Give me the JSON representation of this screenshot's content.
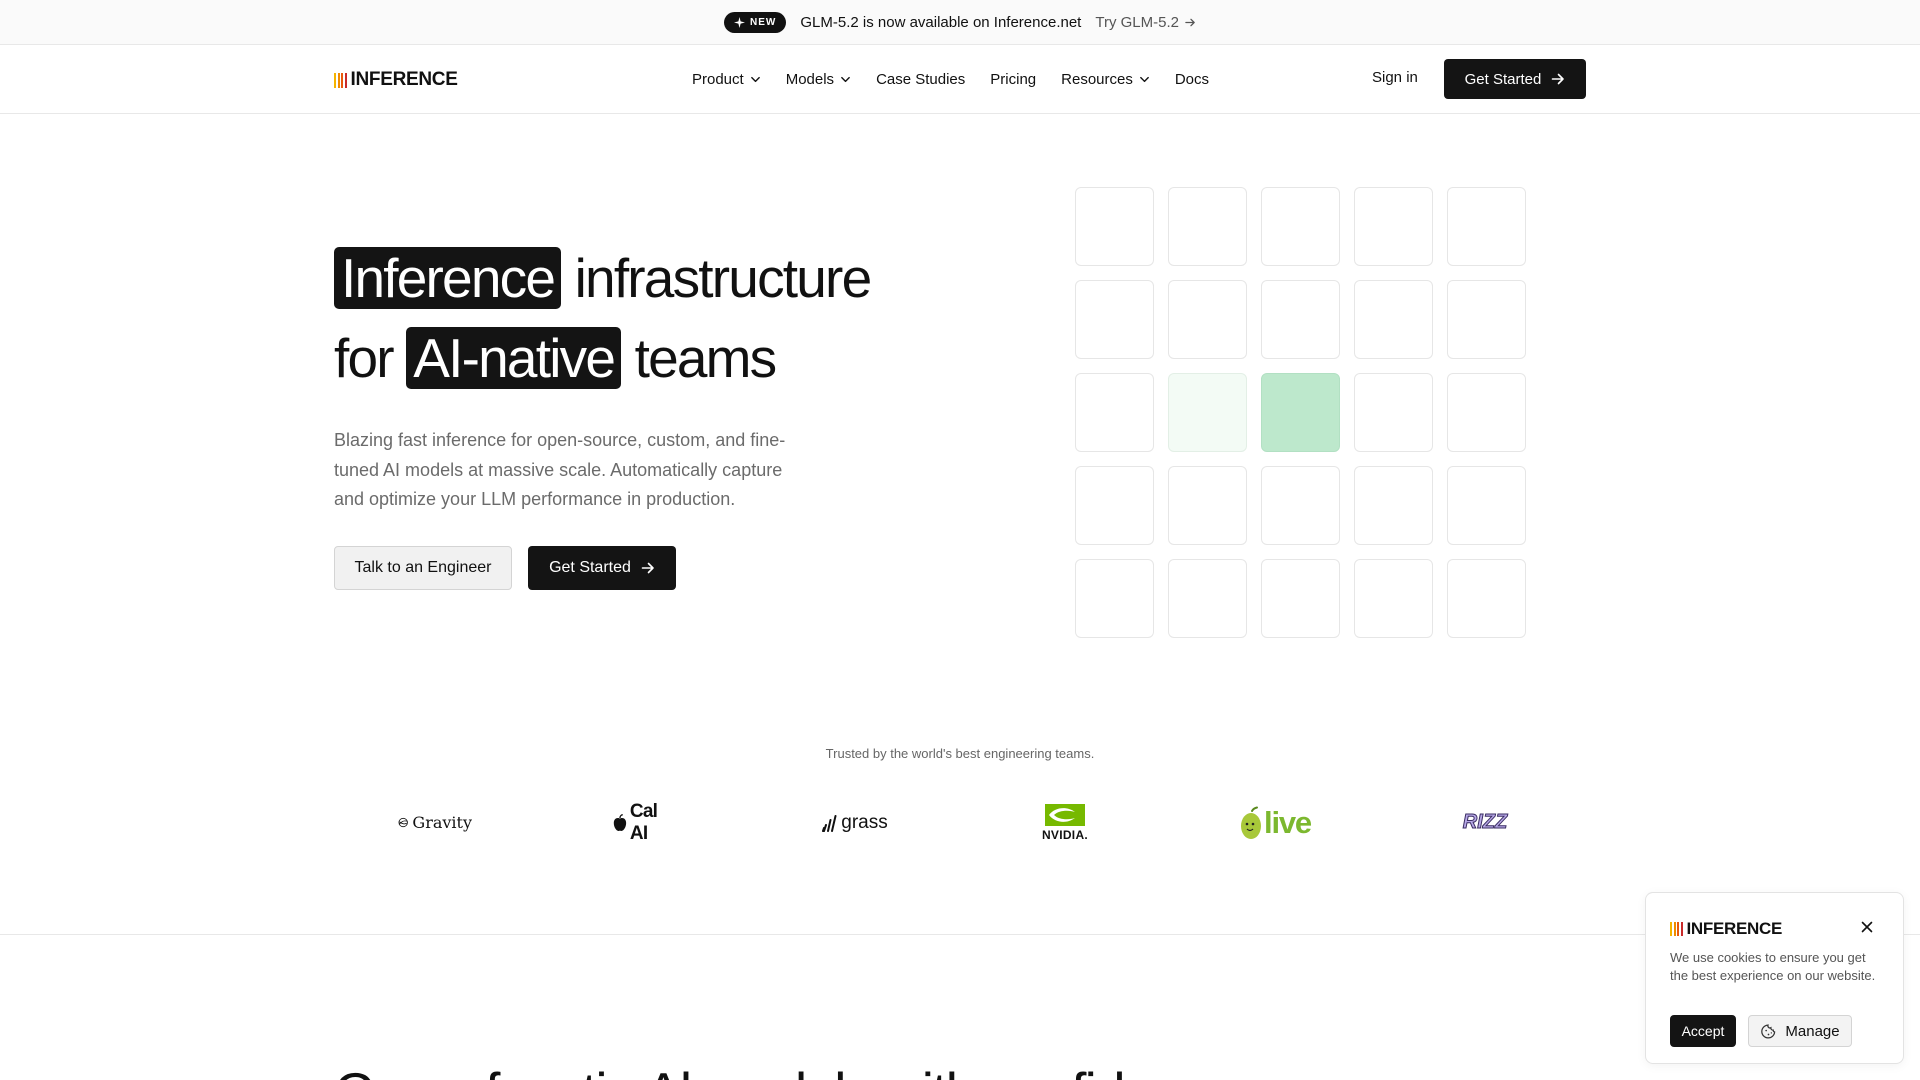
{
  "announcement": {
    "badge": "NEW",
    "text": "GLM-5.2 is now available on Inference.net",
    "link": "Try GLM-5.2"
  },
  "brand": {
    "name": "INFERENCE",
    "bar_colors": [
      "#f5b400",
      "#f08c00",
      "#e8590c",
      "#c92a2a"
    ]
  },
  "nav": {
    "items": [
      {
        "label": "Product",
        "dropdown": true
      },
      {
        "label": "Models",
        "dropdown": true
      },
      {
        "label": "Case Studies",
        "dropdown": false
      },
      {
        "label": "Pricing",
        "dropdown": false
      },
      {
        "label": "Resources",
        "dropdown": true
      },
      {
        "label": "Docs",
        "dropdown": false
      }
    ],
    "sign_in": "Sign in",
    "get_started": "Get Started"
  },
  "hero": {
    "title_hl1": "Inference",
    "title_part1": " infrastructure",
    "title_part2": "for ",
    "title_hl2": "AI-native",
    "title_part3": " teams",
    "subtitle": "Blazing fast inference for open-source, custom, and fine-tuned AI models at massive scale. Automatically capture and optimize your LLM performance in production.",
    "cta_secondary": "Talk to an Engineer",
    "cta_primary": "Get Started"
  },
  "trusted": {
    "text": "Trusted by the world's best engineering teams.",
    "logos": [
      {
        "name": "Gravity"
      },
      {
        "name": "Cal AI"
      },
      {
        "name": "grass"
      },
      {
        "name": "NVIDIA."
      },
      {
        "name": "live"
      },
      {
        "name": "RIZZ"
      }
    ]
  },
  "next_section": {
    "heading": "Cross-functio Al models with confid"
  },
  "cookie": {
    "text": "We use cookies to ensure you get the best experience on our website.",
    "accept": "Accept",
    "manage": "Manage"
  },
  "colors": {
    "accent_dark": "#141414",
    "grid_highlight": "#bde8cc",
    "grid_light": "#f3fbf5",
    "olive_green": "#7cb82f",
    "nvidia_green": "#76b900"
  }
}
